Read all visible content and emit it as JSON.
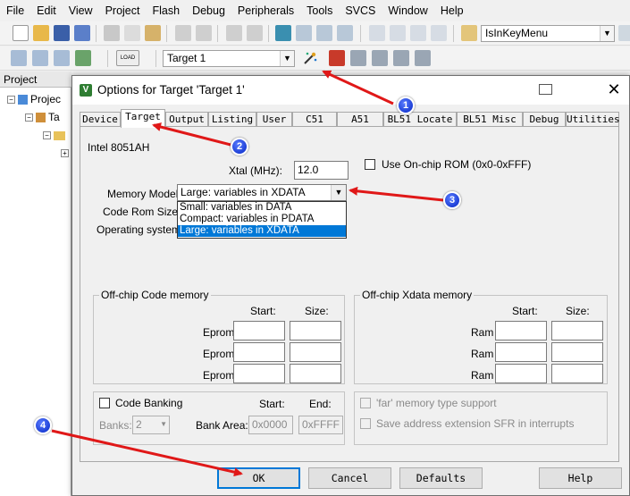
{
  "menu": [
    "File",
    "Edit",
    "View",
    "Project",
    "Flash",
    "Debug",
    "Peripherals",
    "Tools",
    "SVCS",
    "Window",
    "Help"
  ],
  "toolbar": {
    "function_combo": "IsInKeyMenu",
    "target_combo": "Target 1",
    "load_label": "LOAD"
  },
  "project_pane": {
    "header": "Project",
    "tree": [
      "Projec",
      "Ta"
    ]
  },
  "dialog": {
    "title": "Options for Target 'Target 1'",
    "tabs": [
      "Device",
      "Target",
      "Output",
      "Listing",
      "User",
      "C51",
      "A51",
      "BL51 Locate",
      "BL51 Misc",
      "Debug",
      "Utilities"
    ],
    "active_tab": "Target",
    "device": "Intel 8051AH",
    "xtal_label": "Xtal (MHz):",
    "xtal_value": "12.0",
    "onchip_rom_label": "Use On-chip ROM (0x0-0xFFF)",
    "memory_model_label": "Memory Model:",
    "memory_model_value": "Large: variables in XDATA",
    "memory_model_options": [
      "Small: variables in DATA",
      "Compact: variables in PDATA",
      "Large: variables in XDATA"
    ],
    "code_rom_label": "Code Rom Size:",
    "os_label": "Operating system:",
    "offchip_code": {
      "title": "Off-chip Code memory",
      "start_label": "Start:",
      "size_label": "Size:",
      "rows": [
        "Eprom",
        "Eprom",
        "Eprom"
      ]
    },
    "offchip_xdata": {
      "title": "Off-chip Xdata memory",
      "start_label": "Start:",
      "size_label": "Size:",
      "rows": [
        "Ram",
        "Ram",
        "Ram"
      ]
    },
    "banking": {
      "code_banking_label": "Code Banking",
      "start_label": "Start:",
      "end_label": "End:",
      "banks_label": "Banks:",
      "banks_value": "2",
      "bank_area_label": "Bank Area:",
      "bank_start": "0x0000",
      "bank_end": "0xFFFF"
    },
    "far_memory_label": "'far' memory type support",
    "save_sfr_label": "Save address extension SFR in interrupts",
    "buttons": {
      "ok": "OK",
      "cancel": "Cancel",
      "defaults": "Defaults",
      "help": "Help"
    }
  },
  "annotations": [
    "1",
    "2",
    "3",
    "4"
  ],
  "colors": {
    "arrow": "#e01818",
    "badge": "#1d3fd6",
    "selection": "#0078d7"
  }
}
